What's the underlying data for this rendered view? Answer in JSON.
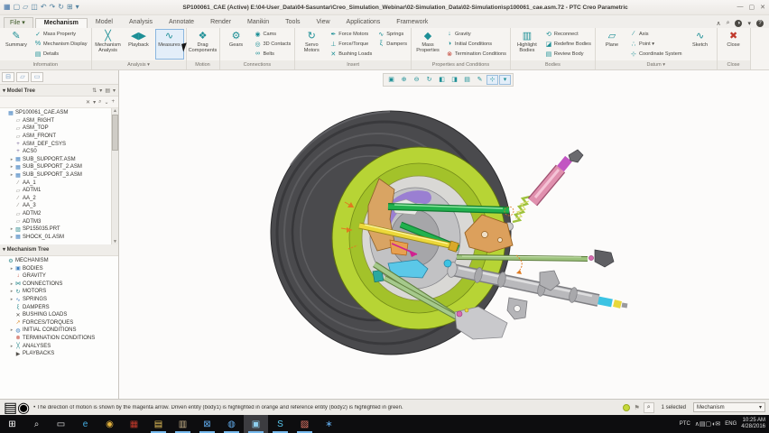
{
  "window": {
    "title": "SP100061_CAE (Active) E:\\04-User_Data\\04-Sasuntar\\Creo_Simulation_Webinar\\02-Simulation_Data\\02-Simulation\\sp100061_cae.asm.72 - PTC Creo Parametric",
    "controls": [
      {
        "name": "minimize-button",
        "glyph": "—"
      },
      {
        "name": "restore-button",
        "glyph": "▢"
      },
      {
        "name": "close-window-button",
        "glyph": "✕"
      }
    ]
  },
  "quick_access": [
    {
      "name": "app-icon",
      "glyph": "▦",
      "color": "#3a6ea5"
    },
    {
      "name": "new-file-icon",
      "glyph": "▢"
    },
    {
      "name": "open-file-icon",
      "glyph": "▱"
    },
    {
      "name": "save-icon",
      "glyph": "◫"
    },
    {
      "name": "undo-icon",
      "glyph": "↶"
    },
    {
      "name": "redo-icon",
      "glyph": "↷"
    },
    {
      "name": "regenerate-icon",
      "glyph": "↻"
    },
    {
      "name": "window-icon",
      "glyph": "⊞"
    },
    {
      "name": "qat-dropdown-icon",
      "glyph": "▾"
    }
  ],
  "file_button": "File ▾",
  "tabs": [
    {
      "label": "Mechanism",
      "active": true
    },
    {
      "label": "Model"
    },
    {
      "label": "Analysis"
    },
    {
      "label": "Annotate"
    },
    {
      "label": "Render"
    },
    {
      "label": "Manikin"
    },
    {
      "label": "Tools"
    },
    {
      "label": "View"
    },
    {
      "label": "Applications"
    },
    {
      "label": "Framework"
    }
  ],
  "header_right_icons": [
    {
      "name": "minimize-ribbon-icon",
      "glyph": "∧"
    },
    {
      "name": "command-search-icon",
      "glyph": "⌕"
    },
    {
      "name": "session-icon",
      "glyph": "◑",
      "dark": true
    },
    {
      "name": "session-dropdown-icon",
      "glyph": "▾"
    },
    {
      "name": "help-icon",
      "glyph": "?",
      "dark": true
    }
  ],
  "ribbon": {
    "groups": [
      {
        "label": "Information",
        "items": [
          {
            "kind": "big",
            "buttons": [
              {
                "label": "Summary",
                "icon": "✎"
              }
            ]
          },
          {
            "kind": "stack",
            "buttons": [
              {
                "label": "Mass Property",
                "icon": "✓"
              },
              {
                "label": "Mechanism Display",
                "icon": "%"
              },
              {
                "label": "Details",
                "icon": "▤"
              }
            ]
          }
        ]
      },
      {
        "label": "Analysis",
        "dropdown": true,
        "items": [
          {
            "kind": "big",
            "buttons": [
              {
                "label": "Mechanism Analysis",
                "icon": "╳"
              },
              {
                "label": "Playback",
                "icon": "◀▶"
              },
              {
                "label": "Measures",
                "icon": "∿",
                "hover": true
              }
            ]
          }
        ]
      },
      {
        "label": "Motion",
        "items": [
          {
            "kind": "big",
            "buttons": [
              {
                "label": "Drag Components",
                "icon": "❖"
              }
            ]
          }
        ]
      },
      {
        "label": "Connections",
        "items": [
          {
            "kind": "big",
            "buttons": [
              {
                "label": "Gears",
                "icon": "⚙"
              }
            ]
          },
          {
            "kind": "stack",
            "buttons": [
              {
                "label": "Cams",
                "icon": "◉"
              },
              {
                "label": "3D Contacts",
                "icon": "◎"
              },
              {
                "label": "Belts",
                "icon": "∞"
              }
            ]
          }
        ]
      },
      {
        "label": "Insert",
        "items": [
          {
            "kind": "big",
            "buttons": [
              {
                "label": "Servo Motors",
                "icon": "↻"
              }
            ]
          },
          {
            "kind": "stack",
            "buttons": [
              {
                "label": "Force Motors",
                "icon": "✒"
              },
              {
                "label": "Force/Torque",
                "icon": "⊥"
              },
              {
                "label": "Bushing Loads",
                "icon": "✕"
              }
            ]
          },
          {
            "kind": "stack",
            "buttons": [
              {
                "label": "Springs",
                "icon": "∿"
              },
              {
                "label": "Dampers",
                "icon": "ξ"
              }
            ]
          }
        ]
      },
      {
        "label": "Properties and Conditions",
        "items": [
          {
            "kind": "big",
            "buttons": [
              {
                "label": "Mass Properties",
                "icon": "◆"
              }
            ]
          },
          {
            "kind": "stack",
            "buttons": [
              {
                "label": "Gravity",
                "icon": "↓"
              },
              {
                "label": "Initial Conditions",
                "icon": "◑"
              },
              {
                "label": "Termination Conditions",
                "icon": "⊗",
                "color": "#c0392b"
              }
            ]
          }
        ]
      },
      {
        "label": "Bodies",
        "items": [
          {
            "kind": "big",
            "buttons": [
              {
                "label": "Highlight Bodies",
                "icon": "▥"
              }
            ]
          },
          {
            "kind": "stack",
            "buttons": [
              {
                "label": "Reconnect",
                "icon": "⟲"
              },
              {
                "label": "Redefine Bodies",
                "icon": "◪"
              },
              {
                "label": "Review Body",
                "icon": "▤"
              }
            ]
          }
        ]
      },
      {
        "label": "Datum",
        "dropdown": true,
        "items": [
          {
            "kind": "big",
            "buttons": [
              {
                "label": "Plane",
                "icon": "▱"
              }
            ]
          },
          {
            "kind": "stack",
            "buttons": [
              {
                "label": "Axis",
                "icon": "∕"
              },
              {
                "label": "Point",
                "icon": "∴",
                "dropdown": true
              },
              {
                "label": "Coordinate System",
                "icon": "⊹"
              }
            ]
          },
          {
            "kind": "big",
            "buttons": [
              {
                "label": "Sketch",
                "icon": "∿"
              }
            ]
          }
        ]
      },
      {
        "label": "Close",
        "items": [
          {
            "kind": "big",
            "buttons": [
              {
                "label": "Close",
                "icon": "✖",
                "color": "#c0392b"
              }
            ]
          }
        ]
      }
    ]
  },
  "graphics_toolbar": [
    {
      "name": "refit-icon",
      "glyph": "▣"
    },
    {
      "name": "zoom-in-icon",
      "glyph": "⊕"
    },
    {
      "name": "zoom-out-icon",
      "glyph": "⊖"
    },
    {
      "name": "repaint-icon",
      "glyph": "↻"
    },
    {
      "name": "display-style-icon",
      "glyph": "◧"
    },
    {
      "name": "section-icon",
      "glyph": "◨"
    },
    {
      "name": "saved-orientations-icon",
      "glyph": "▤"
    },
    {
      "name": "annotation-display-icon",
      "glyph": "✎"
    },
    {
      "name": "spin-center-icon",
      "glyph": "⊹",
      "pressed": true
    },
    {
      "name": "view-manager-icon",
      "glyph": "▾",
      "pressed": true
    }
  ],
  "panel_tabs": [
    {
      "name": "model-tree-tab-icon",
      "glyph": "⊟"
    },
    {
      "name": "folder-browser-tab-icon",
      "glyph": "▱"
    },
    {
      "name": "favorites-tab-icon",
      "glyph": "▭"
    }
  ],
  "model_tree": {
    "title": "▾ Model Tree",
    "header_icons": [
      {
        "name": "tree-settings-icon",
        "glyph": "⇅"
      },
      {
        "name": "tree-settings-dropdown-icon",
        "glyph": "▾"
      },
      {
        "name": "tree-columns-icon",
        "glyph": "▤"
      },
      {
        "name": "tree-columns-dropdown-icon",
        "glyph": "▾"
      }
    ],
    "search_icons": [
      {
        "name": "clear-filter-icon",
        "glyph": "✕"
      },
      {
        "name": "filter-dropdown-icon",
        "glyph": "▾"
      },
      {
        "name": "find-icon",
        "glyph": "⌕"
      },
      {
        "name": "collapse-icon",
        "glyph": "⌄"
      },
      {
        "name": "expand-icon",
        "glyph": "+"
      }
    ],
    "items": [
      {
        "icon": "▦",
        "color": "#3f7fbf",
        "label": "SP100061_CAE.ASM",
        "indent": 0
      },
      {
        "icon": "▱",
        "color": "#8a8780",
        "label": "ASM_RIGHT",
        "indent": 1
      },
      {
        "icon": "▱",
        "color": "#8a8780",
        "label": "ASM_TOP",
        "indent": 1
      },
      {
        "icon": "▱",
        "color": "#8a8780",
        "label": "ASM_FRONT",
        "indent": 1
      },
      {
        "icon": "+",
        "color": "#7a6a9a",
        "label": "ASM_DEF_CSYS",
        "indent": 1
      },
      {
        "icon": "+",
        "color": "#7a6a9a",
        "label": "ACS0",
        "indent": 1
      },
      {
        "arrow": true,
        "icon": "▦",
        "color": "#3f7fbf",
        "label": "SUB_SUPPORT.ASM",
        "indent": 1
      },
      {
        "arrow": true,
        "icon": "▦",
        "color": "#3f7fbf",
        "label": "SUB_SUPPORT_2.ASM",
        "indent": 1
      },
      {
        "arrow": true,
        "icon": "▦",
        "color": "#3f7fbf",
        "label": "SUB_SUPPORT_3.ASM",
        "indent": 1
      },
      {
        "icon": "∕",
        "color": "#8a8780",
        "label": "AA_1",
        "indent": 1
      },
      {
        "icon": "▱",
        "color": "#8a8780",
        "label": "ADTM1",
        "indent": 1
      },
      {
        "icon": "∕",
        "color": "#8a8780",
        "label": "AA_2",
        "indent": 1
      },
      {
        "icon": "∕",
        "color": "#8a8780",
        "label": "AA_3",
        "indent": 1
      },
      {
        "icon": "▱",
        "color": "#8a8780",
        "label": "ADTM2",
        "indent": 1
      },
      {
        "icon": "▱",
        "color": "#8a8780",
        "label": "ADTM3",
        "indent": 1
      },
      {
        "arrow": true,
        "icon": "▨",
        "color": "#2e8b8f",
        "label": "SP155035.PRT",
        "indent": 1
      },
      {
        "arrow": true,
        "icon": "▦",
        "color": "#3f7fbf",
        "label": "SHOCK_01.ASM",
        "indent": 1
      }
    ]
  },
  "mechanism_tree": {
    "title": "▾ Mechanism Tree",
    "items": [
      {
        "icon": "⚙",
        "color": "#2e8b8f",
        "label": "MECHANISM",
        "indent": 0
      },
      {
        "arrow": true,
        "icon": "▣",
        "color": "#3f7fbf",
        "label": "BODIES",
        "indent": 1
      },
      {
        "icon": "↓",
        "color": "#c0392b",
        "label": "GRAVITY",
        "indent": 1
      },
      {
        "arrow": true,
        "icon": "⋈",
        "color": "#2e8b8f",
        "label": "CONNECTIONS",
        "indent": 1
      },
      {
        "arrow": true,
        "icon": "↻",
        "color": "#2e8b8f",
        "label": "MOTORS",
        "indent": 1
      },
      {
        "arrow": true,
        "icon": "∿",
        "color": "#3f7fbf",
        "label": "SPRINGS",
        "indent": 1
      },
      {
        "icon": "ξ",
        "color": "#2e8b8f",
        "label": "DAMPERS",
        "indent": 1
      },
      {
        "icon": "✕",
        "color": "#55524d",
        "label": "BUSHING LOADS",
        "indent": 1
      },
      {
        "icon": "↗",
        "color": "#d98a2b",
        "label": "FORCES/TORQUES",
        "indent": 1
      },
      {
        "arrow": true,
        "icon": "◍",
        "color": "#3f7fbf",
        "label": "INITIAL CONDITIONS",
        "indent": 1
      },
      {
        "icon": "⊗",
        "color": "#c0392b",
        "label": "TERMINATION CONDITIONS",
        "indent": 1
      },
      {
        "arrow": true,
        "icon": "╳",
        "color": "#2e8b8f",
        "label": "ANALYSES",
        "indent": 1
      },
      {
        "icon": "▶",
        "color": "#55524d",
        "label": "PLAYBACKS",
        "indent": 1
      }
    ]
  },
  "status_bar": {
    "left_icons": [
      {
        "name": "message-log-icon",
        "glyph": "▤"
      },
      {
        "name": "model-info-icon",
        "glyph": "◉"
      }
    ],
    "message": "• The direction of motion is shown by the magenta arrow. Driven entity (body1) is highlighted in orange and reference entity (body2) is highlighted in green.",
    "selected_count": "1 selected",
    "filter_value": "Mechanism",
    "filter_arrow": "▾",
    "binoculars_icon": "⌕",
    "flag_icon": "⚑",
    "indicator_color": "#c6d93a"
  },
  "taskbar": {
    "icons": [
      {
        "name": "start-button",
        "glyph": "⊞",
        "color": "#ffffff"
      },
      {
        "name": "search-icon",
        "glyph": "⌕",
        "color": "#e0e0e0"
      },
      {
        "name": "task-view-icon",
        "glyph": "▭",
        "color": "#e0e0e0"
      },
      {
        "name": "edge-browser-icon",
        "glyph": "e",
        "color": "#45b0e6"
      },
      {
        "name": "chrome-icon",
        "glyph": "◉",
        "color": "#e2b13c"
      },
      {
        "name": "app-red-icon",
        "glyph": "▦",
        "color": "#c0392b"
      },
      {
        "name": "file-explorer-icon",
        "glyph": "▤",
        "color": "#e8c35a",
        "underline": true
      },
      {
        "name": "app-tan-icon",
        "glyph": "▥",
        "color": "#c9b38a",
        "underline": true
      },
      {
        "name": "outlook-icon",
        "glyph": "⊠",
        "color": "#5fa8e8",
        "underline": true
      },
      {
        "name": "lync-icon",
        "glyph": "◍",
        "color": "#5fa8e8",
        "underline": true
      },
      {
        "name": "creo-parametric-icon",
        "glyph": "▣",
        "color": "#8fd0f0",
        "underline": true,
        "active": true
      },
      {
        "name": "skype-icon",
        "glyph": "S",
        "color": "#58c8f0",
        "underline": true
      },
      {
        "name": "powerpoint-icon",
        "glyph": "▨",
        "color": "#e87a6a",
        "underline": true
      },
      {
        "name": "app-asterisk-icon",
        "glyph": "∗",
        "color": "#5fa8e8"
      }
    ],
    "tray": {
      "brand": "PTC",
      "icons": [
        {
          "name": "tray-chevron-icon",
          "glyph": "∧"
        },
        {
          "name": "tray-folder-icon",
          "glyph": "▤"
        },
        {
          "name": "tray-display-icon",
          "glyph": "▢"
        },
        {
          "name": "tray-volume-icon",
          "glyph": "◖"
        },
        {
          "name": "tray-chat-icon",
          "glyph": "✉"
        }
      ],
      "lang": "ENG",
      "time": "10:25 AM",
      "date": "4/28/2016"
    }
  },
  "viewport": {
    "background": "#fcfbfa",
    "part_colors": {
      "tire": "#4a4a4d",
      "rim": "#b7d435",
      "rim_inner": "#a3c22a",
      "cavity": "#d9d8d5",
      "brake_disc": "#c2c2c4",
      "caliper": "#9a7fd2",
      "upright": "#d9a463",
      "rocker": "#dca05c",
      "upper_arm": "#21b14e",
      "tie_rod": "#ecd73a",
      "lower_arm": "#a5c98b",
      "long_tie_rod": "#9cc27c",
      "shock_body": "#e090ae",
      "shock_cap": "#c255c2",
      "spring": "#9ec23d",
      "rack": "#b9b9bc",
      "cyan_joint": "#3cc3e3",
      "light_blue": "#5bc8e8",
      "pink_joint": "#d86ab0",
      "highlight_orange": "#e07a1f",
      "magenta_arrow": "#d02090"
    }
  }
}
